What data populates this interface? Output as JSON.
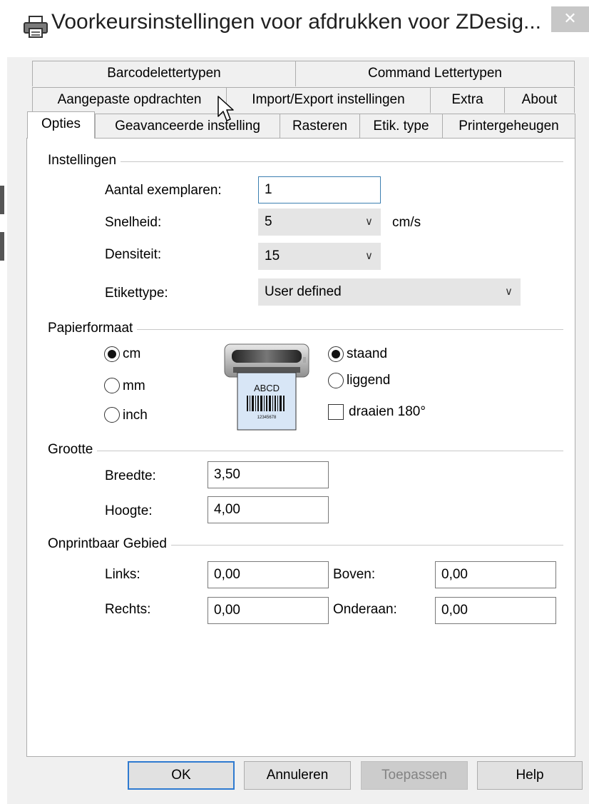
{
  "window": {
    "title": "Voorkeursinstellingen voor afdrukken voor ZDesig...",
    "close_glyph": "✕",
    "icon": "printer-icon"
  },
  "tabs": {
    "row1": [
      "Barcodelettertypen",
      "Command Lettertypen"
    ],
    "row2": [
      "Aangepaste opdrachten",
      "Import/Export instellingen",
      "Extra",
      "About"
    ],
    "row3": [
      "Opties",
      "Geavanceerde instelling",
      "Rasteren",
      "Etik. type",
      "Printergeheugen"
    ],
    "active": "Opties"
  },
  "instellingen": {
    "group_label": "Instellingen",
    "copies_label": "Aantal exemplaren:",
    "copies_value": "1",
    "speed_label": "Snelheid:",
    "speed_value": "5",
    "speed_unit": "cm/s",
    "density_label": "Densiteit:",
    "density_value": "15",
    "label_type_label": "Etikettype:",
    "label_type_value": "User defined"
  },
  "papierformaat": {
    "group_label": "Papierformaat",
    "unit_cm": "cm",
    "unit_mm": "mm",
    "unit_inch": "inch",
    "selected_unit": "cm",
    "orient_staand": "staand",
    "orient_liggend": "liggend",
    "rotate_label": "draaien 180°",
    "selected_orientation": "staand",
    "rotate_checked": false,
    "preview_text": "ABCD",
    "preview_digits": "12345678"
  },
  "grootte": {
    "group_label": "Grootte",
    "width_label": "Breedte:",
    "width_value": "3,50",
    "height_label": "Hoogte:",
    "height_value": "4,00"
  },
  "onprintbaar": {
    "group_label": "Onprintbaar Gebied",
    "left_label": "Links:",
    "left_value": "0,00",
    "top_label": "Boven:",
    "top_value": "0,00",
    "right_label": "Rechts:",
    "right_value": "0,00",
    "bottom_label": "Onderaan:",
    "bottom_value": "0,00"
  },
  "buttons": {
    "ok": "OK",
    "cancel": "Annuleren",
    "apply": "Toepassen",
    "help": "Help"
  },
  "colors": {
    "accent": "#3c7fb1",
    "default_button_border": "#2e7ad0",
    "dialog_bg": "#f0f0f0"
  }
}
